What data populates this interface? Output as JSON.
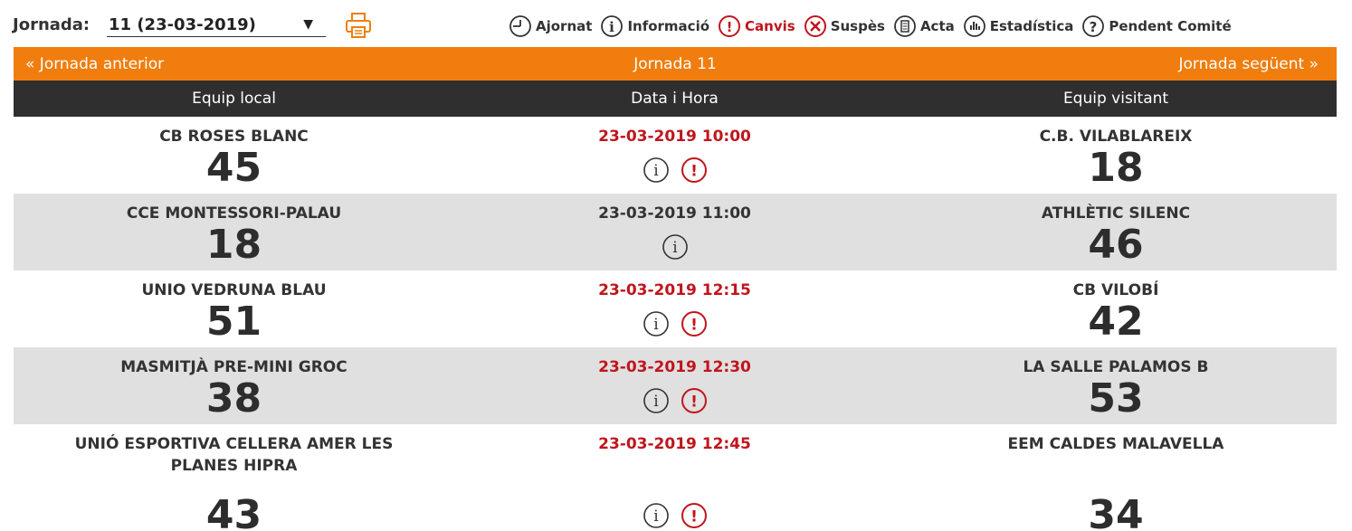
{
  "toolbar": {
    "jornada_label": "Jornada:",
    "jornada_value": "11 (23-03-2019)",
    "legend": [
      {
        "label": "Ajornat",
        "icon": "clock-icon"
      },
      {
        "label": "Informació",
        "icon": "info-icon"
      },
      {
        "label": "Canvis",
        "icon": "alert-icon"
      },
      {
        "label": "Suspès",
        "icon": "cancel-icon"
      },
      {
        "label": "Acta",
        "icon": "document-icon"
      },
      {
        "label": "Estadística",
        "icon": "stats-icon"
      },
      {
        "label": "Pendent Comité",
        "icon": "question-icon"
      }
    ]
  },
  "nav": {
    "prev": "« Jornada anterior",
    "current": "Jornada 11",
    "next": "Jornada següent »"
  },
  "header": {
    "local": "Equip local",
    "date": "Data i Hora",
    "visit": "Equip visitant"
  },
  "colors": {
    "accent": "#f07d0d",
    "header_bg": "#2f2f2f",
    "changed_red": "#c0151c",
    "alt_row": "#e0e0e0"
  },
  "matches": [
    {
      "local": "CB ROSES BLANC",
      "local_score": "45",
      "datetime": "23-03-2019 10:00",
      "visit": "C.B. VILABLAREIX",
      "visit_score": "18",
      "changed": true,
      "icons": [
        "info-icon",
        "alert-icon"
      ]
    },
    {
      "local": "CCE MONTESSORI-PALAU",
      "local_score": "18",
      "datetime": "23-03-2019 11:00",
      "visit": "ATHLÈTIC SILENC",
      "visit_score": "46",
      "changed": false,
      "icons": [
        "info-icon"
      ]
    },
    {
      "local": "UNIO VEDRUNA BLAU",
      "local_score": "51",
      "datetime": "23-03-2019 12:15",
      "visit": "CB VILOBÍ",
      "visit_score": "42",
      "changed": true,
      "icons": [
        "info-icon",
        "alert-icon"
      ]
    },
    {
      "local": "MASMITJÀ PRE-MINI GROC",
      "local_score": "38",
      "datetime": "23-03-2019 12:30",
      "visit": "LA SALLE PALAMOS B",
      "visit_score": "53",
      "changed": true,
      "icons": [
        "info-icon",
        "alert-icon"
      ]
    },
    {
      "local": "UNIÓ ESPORTIVA CELLERA AMER LES PLANES HIPRA",
      "local_score": "43",
      "datetime": "23-03-2019 12:45",
      "visit": "EEM CALDES MALAVELLA",
      "visit_score": "34",
      "changed": true,
      "icons": [
        "info-icon",
        "alert-icon"
      ]
    }
  ]
}
